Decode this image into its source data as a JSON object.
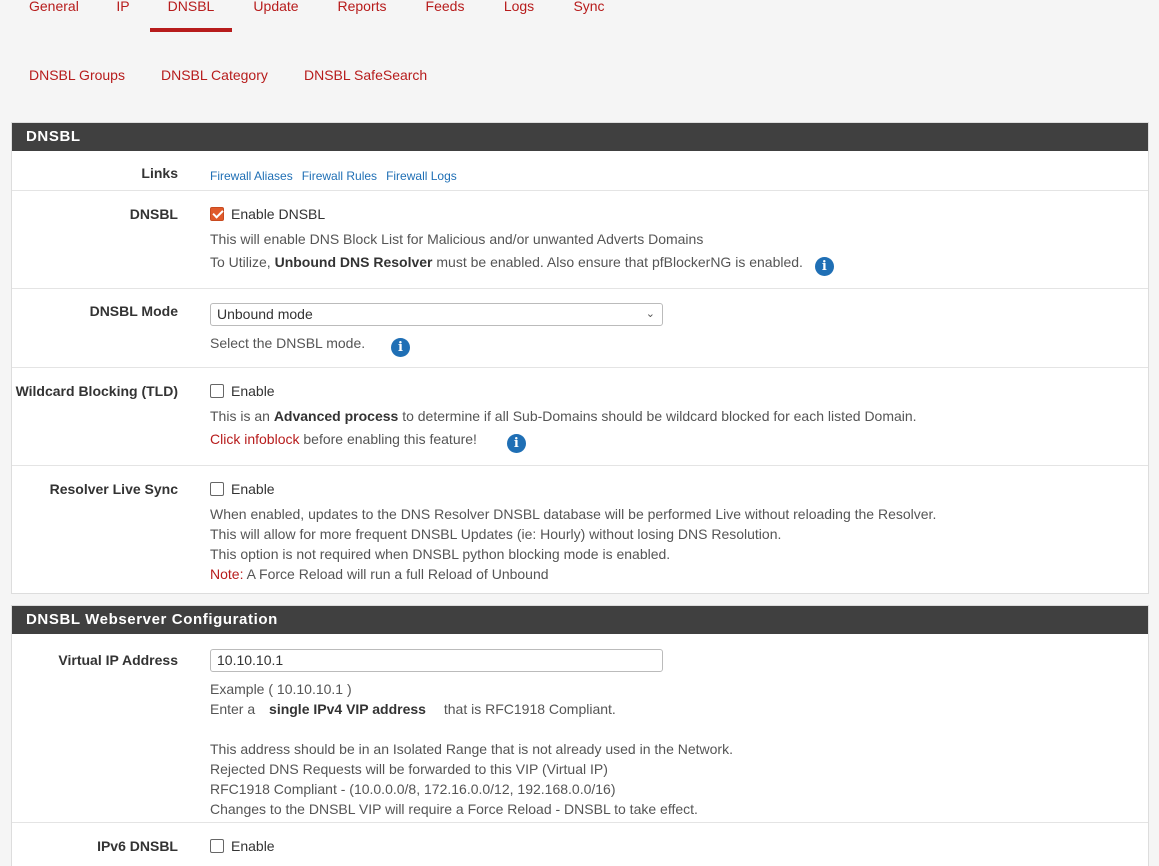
{
  "tabs": [
    {
      "label": "General"
    },
    {
      "label": "IP"
    },
    {
      "label": "DNSBL"
    },
    {
      "label": "Update"
    },
    {
      "label": "Reports"
    },
    {
      "label": "Feeds"
    },
    {
      "label": "Logs"
    },
    {
      "label": "Sync"
    }
  ],
  "subtabs": [
    {
      "label": "DNSBL Groups"
    },
    {
      "label": "DNSBL Category"
    },
    {
      "label": "DNSBL SafeSearch"
    }
  ],
  "dnsbl_panel": {
    "title": "DNSBL",
    "links": {
      "label": "Links",
      "items": [
        "Firewall Aliases",
        "Firewall Rules",
        "Firewall Logs"
      ]
    },
    "dnsbl": {
      "label": "DNSBL",
      "checkbox_label": "Enable DNSBL",
      "checked": true,
      "desc1": "This will enable DNS Block List for Malicious and/or unwanted Adverts Domains",
      "desc2_pre": "To Utilize, ",
      "desc2_bold": "Unbound DNS Resolver",
      "desc2_post": " must be enabled. Also ensure that pfBlockerNG is enabled."
    },
    "mode": {
      "label": "DNSBL Mode",
      "selected": "Unbound mode",
      "desc": "Select the DNSBL mode."
    },
    "wildcard": {
      "label": "Wildcard Blocking (TLD)",
      "checkbox_label": "Enable",
      "desc1_pre": "This is an ",
      "desc1_bold": "Advanced process",
      "desc1_post": " to determine if all Sub-Domains should be wildcard blocked for each listed Domain.",
      "desc2_red": "Click infoblock",
      "desc2_post": " before enabling this feature!"
    },
    "live_sync": {
      "label": "Resolver Live Sync",
      "checkbox_label": "Enable",
      "desc1": "When enabled, updates to the DNS Resolver DNSBL database will be performed Live without reloading the Resolver.",
      "desc2": "This will allow for more frequent DNSBL Updates (ie: Hourly) without losing DNS Resolution.",
      "desc3": "This option is not required when DNSBL python blocking mode is enabled.",
      "note_label": "Note:",
      "note_text": " A Force Reload will run a full Reload of Unbound"
    }
  },
  "webserver_panel": {
    "title": "DNSBL Webserver Configuration",
    "vip": {
      "label": "Virtual IP Address",
      "value": "10.10.10.1",
      "example": "Example ( 10.10.10.1 )",
      "enter_pre": "Enter a ",
      "enter_bold": "single IPv4 VIP address",
      "enter_post": " that is RFC1918 Compliant.",
      "desc1": "This address should be in an Isolated Range that is not already used in the Network.",
      "desc2": "Rejected DNS Requests will be forwarded to this VIP (Virtual IP)",
      "desc3": "RFC1918 Compliant - (10.0.0.0/8, 172.16.0.0/12, 192.168.0.0/16)",
      "desc4": "Changes to the DNSBL VIP will require a Force Reload - DNSBL to take effect."
    },
    "ipv6": {
      "label": "IPv6 DNSBL",
      "checkbox_label": "Enable"
    }
  }
}
